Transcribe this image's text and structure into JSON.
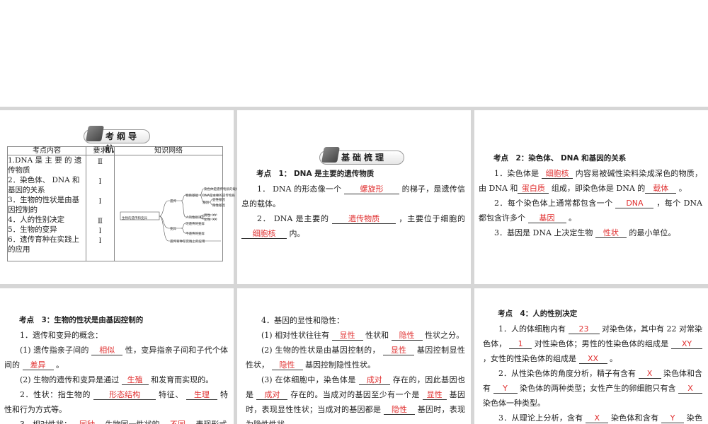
{
  "panel1": {
    "banner": "考纲导航",
    "headers": [
      "考点内容",
      "要求",
      "知识网络"
    ],
    "rows": [
      "1.DNA 是 主 要 的 遗\n传物质",
      "2．染色体、 DNA 和\n基因的关系",
      "3．生物的性状是由基\n因控制的",
      "4．人的性别决定",
      "5．生物的变异",
      "6．遗传育种在实践上\n的应用"
    ],
    "requirements": [
      "Ⅱ",
      "Ⅰ",
      "Ⅰ",
      "Ⅱ",
      "Ⅰ",
      "Ⅰ"
    ],
    "mindmap": {
      "root": "生物的遗传和变异",
      "heredity": "遗传",
      "basis": "物质基础",
      "b1": "染色体是遗传物质的载体",
      "b2": "DNA是主要的遗传物质",
      "gene": "基因",
      "g1": "显性基因",
      "g2": "隐性基因",
      "sex": "人的性别决定",
      "male": "男性: XY",
      "female": "女性: XX",
      "variation": "变异",
      "v1": "可遗传的变异",
      "v2": "不遗传的变异",
      "breeding": "遗传育种在实践上的应用"
    }
  },
  "panel2": {
    "banner": "基础梳理",
    "paragraphs": [
      {
        "head": true,
        "parts": [
          {
            "t": "考点　1：  DNA  是主要的遗传物质"
          }
        ]
      },
      {
        "parts": [
          {
            "t": "1．  DNA  的形态像一个 "
          },
          {
            "b": "螺旋形",
            "w": 78
          },
          {
            "t": " 的梯子，是遗传信息的载体。"
          }
        ]
      },
      {
        "parts": [
          {
            "t": "2．  DNA  是主要的 "
          },
          {
            "b": "遗传物质",
            "w": 90
          },
          {
            "t": " ，主要位于细胞的"
          },
          {
            "b": "细胞核",
            "w": 64
          },
          {
            "t": " 内。"
          }
        ]
      }
    ]
  },
  "panel3": {
    "paragraphs": [
      {
        "head": true,
        "parts": [
          {
            "t": "考点　2：染色体、 DNA  和基因的关系"
          }
        ]
      },
      {
        "parts": [
          {
            "t": "1．染色体是 "
          },
          {
            "b": "细胞核",
            "w": 44
          },
          {
            "t": " 内容易被碱性染料染成深色的物质，由  DNA  和"
          },
          {
            "b": "蛋白质",
            "w": 44
          },
          {
            "t": " 组成，即染色体是  DNA  的"
          },
          {
            "b": "载体",
            "w": 44
          },
          {
            "t": " 。"
          }
        ]
      },
      {
        "parts": [
          {
            "t": "2．每个染色体上通常都包含一个 "
          },
          {
            "b": "DNA",
            "w": 54
          },
          {
            "t": " ，每个  DNA  都包含许多个 "
          },
          {
            "b": "基因",
            "w": 54
          },
          {
            "t": " 。"
          }
        ]
      },
      {
        "parts": [
          {
            "t": "3．基因是  DNA  上决定生物 "
          },
          {
            "b": "性状",
            "w": 44
          },
          {
            "t": " 的最小单位。"
          }
        ]
      }
    ]
  },
  "panel4": {
    "paragraphs": [
      {
        "head": true,
        "parts": [
          {
            "t": "考点　3：生物的性状是由基因控制的"
          }
        ]
      },
      {
        "parts": [
          {
            "t": "1．遗传和变异的概念："
          }
        ]
      },
      {
        "parts": [
          {
            "t": "(1) 遗传指亲子间的 "
          },
          {
            "b": "相似",
            "w": 44
          },
          {
            "t": " 性，变异指亲子间和子代个体间的 "
          },
          {
            "b": "差异",
            "w": 44
          },
          {
            "t": " 。"
          }
        ]
      },
      {
        "parts": [
          {
            "t": "(2) 生物的遗传和变异是通过 "
          },
          {
            "b": "生殖",
            "w": 38
          },
          {
            "t": " 和发育而实现的。"
          }
        ]
      },
      {
        "parts": [
          {
            "t": "2．性状：指生物的 "
          },
          {
            "b": "形态结构",
            "w": 88
          },
          {
            "t": " 特征、 "
          },
          {
            "b": "生理",
            "w": 44
          },
          {
            "t": " 特性和行为方式等。"
          }
        ]
      },
      {
        "parts": [
          {
            "t": "3．相对性状："
          },
          {
            "b": "同种",
            "w": 44
          },
          {
            "t": " 生物同一性状的 "
          },
          {
            "b": "不同",
            "w": 44
          },
          {
            "t": " 表现形式"
          }
        ]
      }
    ]
  },
  "panel5": {
    "paragraphs": [
      {
        "parts": [
          {
            "t": "4．基因的显性和隐性："
          }
        ]
      },
      {
        "parts": [
          {
            "t": "(1) 相对性状往往有 "
          },
          {
            "b": "显性",
            "w": 44
          },
          {
            "t": " 性状和 "
          },
          {
            "b": "隐性",
            "w": 44
          },
          {
            "t": " 性状之分。"
          }
        ]
      },
      {
        "parts": [
          {
            "t": "(2) 生物的性状是由基因控制的， "
          },
          {
            "b": "显性",
            "w": 44
          },
          {
            "t": " 基因控制显性性状， "
          },
          {
            "b": "隐性",
            "w": 44
          },
          {
            "t": " 基因控制隐性性状。"
          }
        ]
      },
      {
        "parts": [
          {
            "t": "(3) 在体细胞中，染色体是 "
          },
          {
            "b": "成对",
            "w": 44
          },
          {
            "t": " 存在的，因此基因也是 "
          },
          {
            "b": "成对",
            "w": 44
          },
          {
            "t": " 存在的。当成对的基因至少有一个是 "
          },
          {
            "b": "显性",
            "w": 34
          },
          {
            "t": " 基因时，表现显性性状；当成对的基因都是 "
          },
          {
            "b": "隐性",
            "w": 44
          },
          {
            "t": " 基因时，表现为隐性性状。"
          }
        ]
      }
    ]
  },
  "panel6": {
    "paragraphs": [
      {
        "head": true,
        "parts": [
          {
            "t": "考点　4：人的性别决定"
          }
        ]
      },
      {
        "parts": [
          {
            "t": "1．人的体细胞内有 "
          },
          {
            "b": "23",
            "w": 44
          },
          {
            "t": " 对染色体，其中有  22  对常染色体， "
          },
          {
            "b": "1",
            "w": 32
          },
          {
            "t": " 对性染色体；男性的性染色体的组成是 "
          },
          {
            "b": "XY",
            "w": 44
          },
          {
            "t": " ，女性的性染色体的组成是 "
          },
          {
            "b": "XX",
            "w": 40
          },
          {
            "t": " 。"
          }
        ]
      },
      {
        "parts": [
          {
            "t": "2．从性染色体的角度分析，精子有含有 "
          },
          {
            "b": "X",
            "w": 32
          },
          {
            "t": " 染色体和含有 "
          },
          {
            "b": "Y",
            "w": 34
          },
          {
            "t": " 染色体的两种类型；女性产生的卵细胞只有含 "
          },
          {
            "b": "X",
            "w": 34
          },
          {
            "t": " 染色体一种类型。"
          }
        ]
      },
      {
        "parts": [
          {
            "t": "3．从理论上分析，含有 "
          },
          {
            "b": "X",
            "w": 32
          },
          {
            "t": " 染色体和含有 "
          },
          {
            "b": "Y",
            "w": 32
          },
          {
            "t": " 染色体"
          }
        ]
      }
    ]
  }
}
